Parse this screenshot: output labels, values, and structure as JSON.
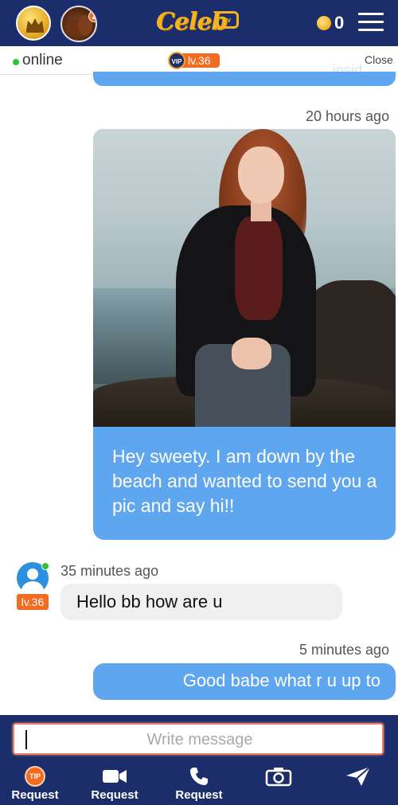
{
  "header": {
    "logo_text": "Celeb",
    "logo_badge": "tv",
    "coin_count": "0",
    "icons": [
      "crown-icon",
      "hot-icon",
      "coin-icon",
      "menu-icon"
    ]
  },
  "status": {
    "online_label": "online",
    "vip_label": "VIP",
    "level_label": "lv.36",
    "close_label": "Close",
    "ghost_text": "insid"
  },
  "messages": [
    {
      "time": "20 hours ago",
      "direction": "outgoing",
      "type": "photo",
      "text": "Hey sweety. I am down by the beach and wanted to send you a pic and say hi!!"
    },
    {
      "time": "35 minutes ago",
      "direction": "incoming",
      "user_level": "lv.36",
      "text": "Hello bb how are u"
    },
    {
      "time": "5 minutes ago",
      "direction": "outgoing",
      "text": "Good babe what r u up to"
    }
  ],
  "composer": {
    "placeholder": "Write message",
    "tip_badge": "TIP",
    "actions": [
      {
        "label": "Request",
        "icon": "tip-icon"
      },
      {
        "label": "Request",
        "icon": "video-icon"
      },
      {
        "label": "Request",
        "icon": "phone-icon"
      },
      {
        "label": "",
        "icon": "camera-icon"
      },
      {
        "label": "",
        "icon": "send-icon"
      }
    ]
  },
  "colors": {
    "header_bg": "#1b2d6b",
    "bubble_out": "#5ea6ef",
    "bubble_in": "#f0f0f0",
    "level_badge": "#f26b21",
    "coin": "#f0b020",
    "online_dot": "#2fc437"
  }
}
